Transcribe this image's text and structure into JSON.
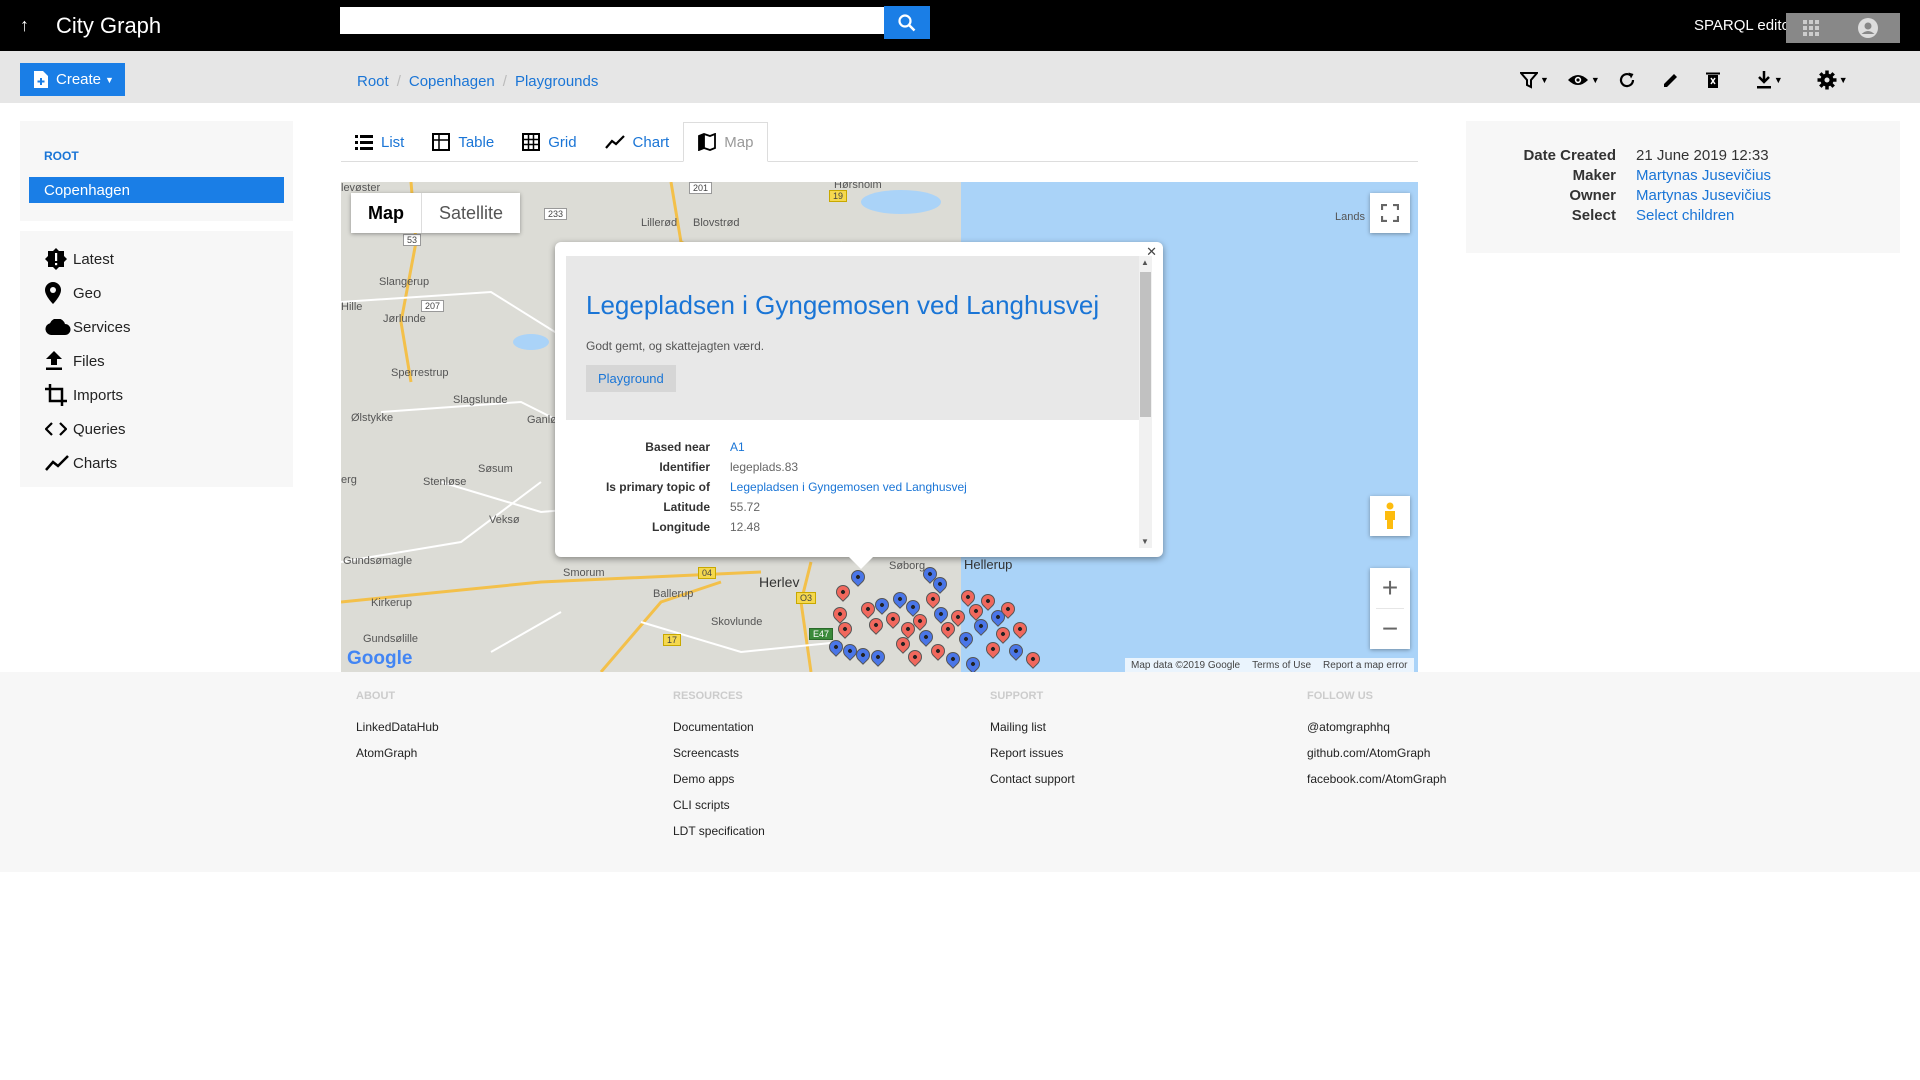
{
  "app": {
    "title": "City Graph",
    "sparql_editor": "SPARQL editor"
  },
  "search": {
    "placeholder": "",
    "value": ""
  },
  "create": {
    "label": "Create"
  },
  "breadcrumb": [
    "Root",
    "Copenhagen",
    "Playgrounds"
  ],
  "toolbar": {
    "icons": [
      "filter-icon",
      "eye-icon",
      "refresh-icon",
      "edit-icon",
      "delete-icon",
      "download-icon",
      "settings-icon"
    ]
  },
  "tree": {
    "root": "ROOT",
    "selected": "Copenhagen"
  },
  "menu": [
    {
      "label": "Latest",
      "icon": "alert-icon"
    },
    {
      "label": "Geo",
      "icon": "location-pin-icon"
    },
    {
      "label": "Services",
      "icon": "cloud-icon"
    },
    {
      "label": "Files",
      "icon": "upload-icon"
    },
    {
      "label": "Imports",
      "icon": "crop-icon"
    },
    {
      "label": "Queries",
      "icon": "code-icon"
    },
    {
      "label": "Charts",
      "icon": "chart-line-icon"
    }
  ],
  "tabs": [
    {
      "label": "List",
      "active": false
    },
    {
      "label": "Table",
      "active": false
    },
    {
      "label": "Grid",
      "active": false
    },
    {
      "label": "Chart",
      "active": false
    },
    {
      "label": "Map",
      "active": true
    }
  ],
  "map": {
    "type_buttons": [
      "Map",
      "Satellite"
    ],
    "selected_type": "Map",
    "logo": "Google",
    "attribution": "Map data ©2019 Google",
    "terms": "Terms of Use",
    "report": "Report a map error",
    "places": [
      "levøster",
      "Hørsholm",
      "Lillerød",
      "Blovstrød",
      "Slangerup",
      "Jørlunde",
      "Hille",
      "Sperrestrup",
      "Slagslunde",
      "Ølstykke",
      "Ganlø",
      "Søsum",
      "Stenløse",
      "erg",
      "Veksø",
      "Gundsømagle",
      "Smorum",
      "Herlev",
      "Søborg",
      "Hellerup",
      "Ballerup",
      "Kirkerup",
      "Skovlunde",
      "Gundsølille",
      "Lands"
    ],
    "roads": [
      "53",
      "201",
      "19",
      "233",
      "207",
      "04",
      "O3",
      "E47",
      "17"
    ]
  },
  "popup": {
    "title": "Legepladsen i Gyngemosen ved Langhusvej",
    "description": "Godt gemt, og skattejagten værd.",
    "type": "Playground",
    "properties": [
      {
        "key": "Based near",
        "value": "A1",
        "link": true
      },
      {
        "key": "Identifier",
        "value": "legeplads.83",
        "link": false
      },
      {
        "key": "Is primary topic of",
        "value": "Legepladsen i Gyngemosen ved Langhusvej",
        "link": true
      },
      {
        "key": "Latitude",
        "value": "55.72",
        "link": false
      },
      {
        "key": "Longitude",
        "value": "12.48",
        "link": false
      }
    ]
  },
  "meta": [
    {
      "key": "Date Created",
      "value": "21 June 2019 12:33",
      "link": false
    },
    {
      "key": "Maker",
      "value": "Martynas Jusevičius",
      "link": true
    },
    {
      "key": "Owner",
      "value": "Martynas Jusevičius",
      "link": true
    },
    {
      "key": "Select",
      "value": "Select children",
      "link": true
    }
  ],
  "footer": [
    {
      "heading": "ABOUT",
      "links": [
        "LinkedDataHub",
        "AtomGraph"
      ]
    },
    {
      "heading": "RESOURCES",
      "links": [
        "Documentation",
        "Screencasts",
        "Demo apps",
        "CLI scripts",
        "LDT specification"
      ]
    },
    {
      "heading": "SUPPORT",
      "links": [
        "Mailing list",
        "Report issues",
        "Contact support"
      ]
    },
    {
      "heading": "FOLLOW US",
      "links": [
        "@atomgraphhq",
        "github.com/AtomGraph",
        "facebook.com/AtomGraph"
      ]
    }
  ]
}
